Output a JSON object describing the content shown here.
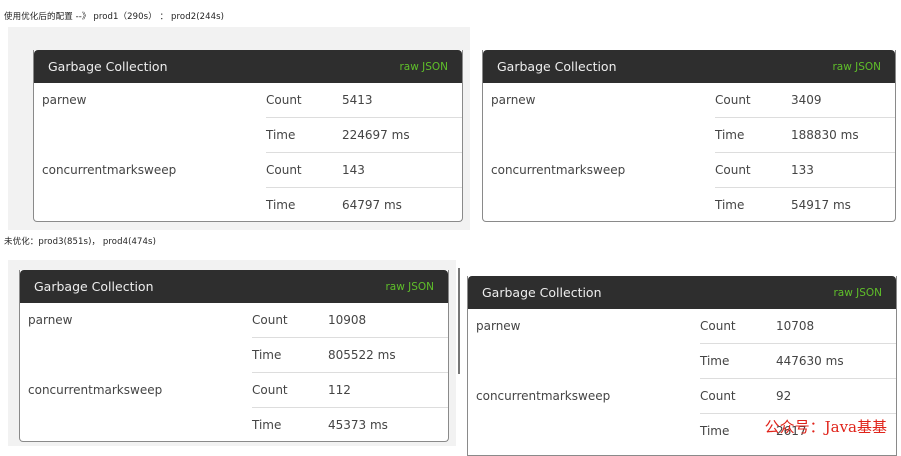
{
  "captions": {
    "optimized": "使用优化后的配置 --》 prod1（290s） ： prod2(244s)",
    "unoptimized": "未优化：prod3(851s)， prod4(474s)"
  },
  "panels": [
    {
      "title": "Garbage Collection",
      "raw_label": "raw JSON",
      "collectors": [
        {
          "name": "parnew",
          "count_label": "Count",
          "count": "5413",
          "time_label": "Time",
          "time": "224697 ms"
        },
        {
          "name": "concurrentmarksweep",
          "count_label": "Count",
          "count": "143",
          "time_label": "Time",
          "time": "64797 ms"
        }
      ]
    },
    {
      "title": "Garbage Collection",
      "raw_label": "raw JSON",
      "collectors": [
        {
          "name": "parnew",
          "count_label": "Count",
          "count": "3409",
          "time_label": "Time",
          "time": "188830 ms"
        },
        {
          "name": "concurrentmarksweep",
          "count_label": "Count",
          "count": "133",
          "time_label": "Time",
          "time": "54917 ms"
        }
      ]
    },
    {
      "title": "Garbage Collection",
      "raw_label": "raw JSON",
      "collectors": [
        {
          "name": "parnew",
          "count_label": "Count",
          "count": "10908",
          "time_label": "Time",
          "time": "805522 ms"
        },
        {
          "name": "concurrentmarksweep",
          "count_label": "Count",
          "count": "112",
          "time_label": "Time",
          "time": "45373 ms"
        }
      ]
    },
    {
      "title": "Garbage Collection",
      "raw_label": "raw JSON",
      "collectors": [
        {
          "name": "parnew",
          "count_label": "Count",
          "count": "10708",
          "time_label": "Time",
          "time": "447630 ms"
        },
        {
          "name": "concurrentmarksweep",
          "count_label": "Count",
          "count": "92",
          "time_label": "Time",
          "time": "2617"
        }
      ]
    }
  ],
  "watermark": "公众号：Java基基"
}
